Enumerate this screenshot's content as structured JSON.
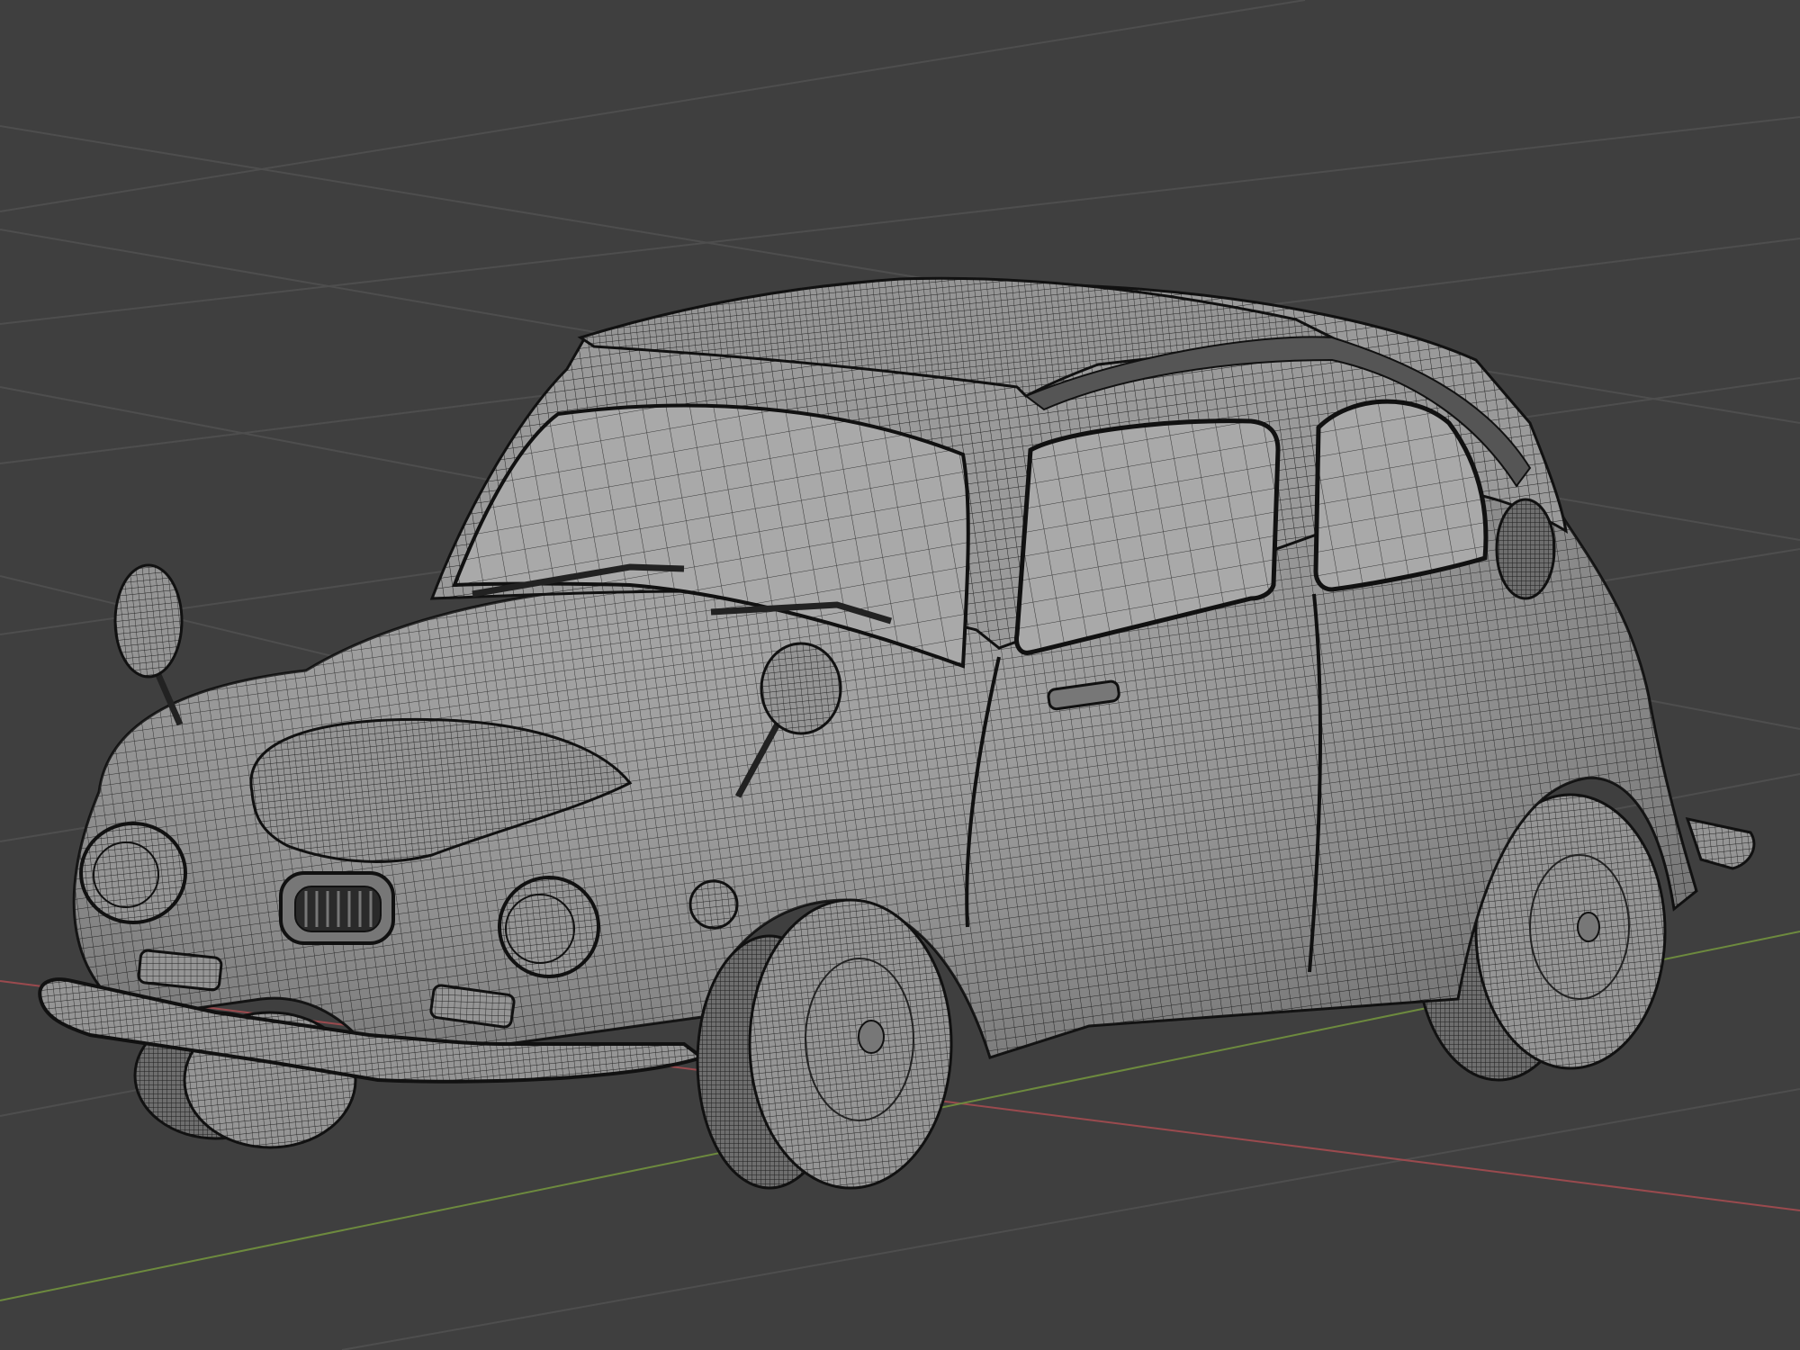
{
  "viewport": {
    "background": "#3f3f3f",
    "grid_color": "#4e4e4e",
    "x_axis_color": "#9a4a4e",
    "y_axis_color": "#6d8a3e"
  },
  "model": {
    "shading": "solid-wireframe",
    "body_color": "#9a9a9a",
    "glass_color": "#a8a8a8",
    "wire_color": "#1e1e1e"
  }
}
